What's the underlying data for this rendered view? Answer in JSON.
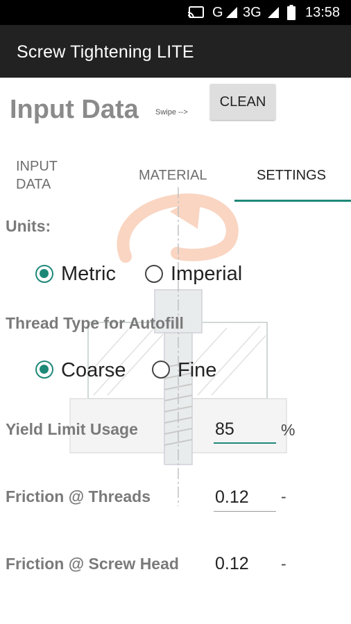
{
  "status_bar": {
    "network_g": "G",
    "network_3g": "3G",
    "time": "13:58"
  },
  "app_bar": {
    "title": "Screw Tightening LITE"
  },
  "header": {
    "title": "Input Data",
    "swipe_hint": "Swipe -->",
    "clean_label": "CLEAN"
  },
  "tabs": {
    "input_data_line1": "INPUT",
    "input_data_line2": "DATA",
    "material": "MATERIAL",
    "settings": "SETTINGS",
    "selected": "SETTINGS"
  },
  "units": {
    "label": "Units:",
    "options": [
      "Metric",
      "Imperial"
    ],
    "selected": "Metric"
  },
  "thread_type": {
    "label": "Thread Type for Autofill",
    "options": [
      "Coarse",
      "Fine"
    ],
    "selected": "Coarse"
  },
  "fields": {
    "yield_limit": {
      "label": "Yield Limit Usage",
      "value": "85",
      "unit": "%"
    },
    "friction_threads": {
      "label": "Friction @ Threads",
      "value": "0.12",
      "unit": "-"
    },
    "friction_head": {
      "label": "Friction @ Screw Head",
      "value": "0.12",
      "unit": "-"
    }
  },
  "colors": {
    "accent": "#1e8878",
    "app_bar": "#222222",
    "status_bar": "#000000",
    "label_gray": "#7a7a7a"
  }
}
